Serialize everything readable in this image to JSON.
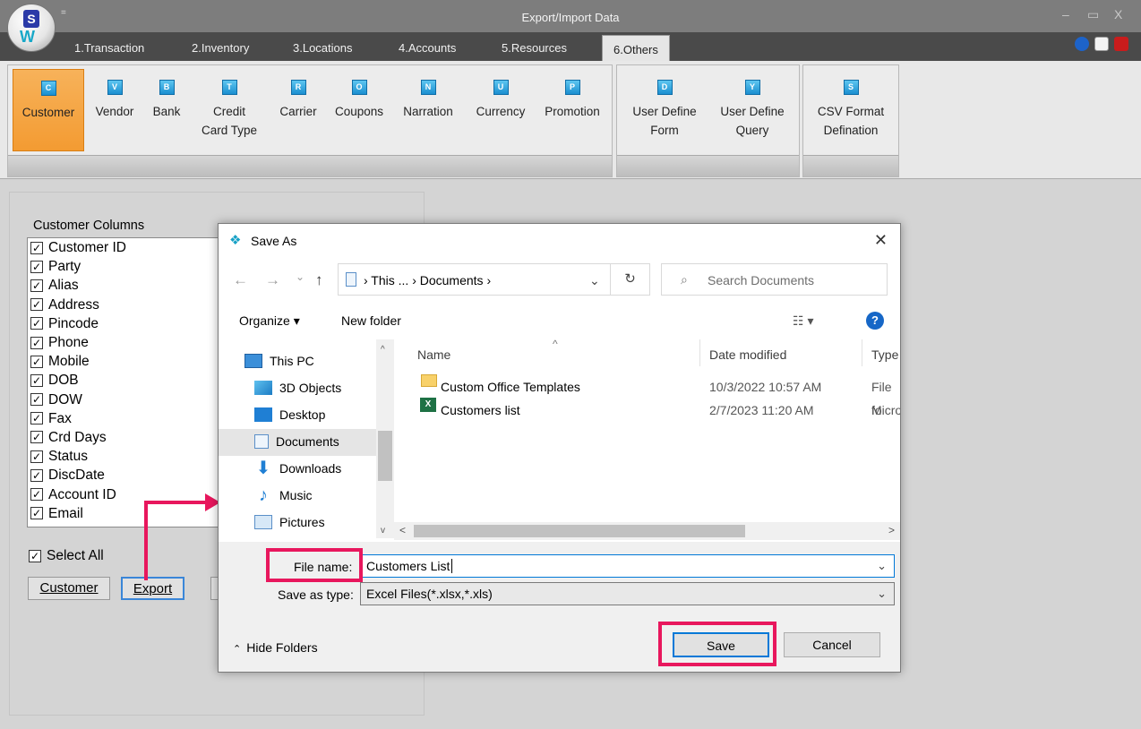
{
  "window": {
    "title": "Export/Import Data",
    "qat_symbol": "=",
    "logo_letter": "S",
    "logo_mark": "W",
    "controls": {
      "minimize": "–",
      "maximize": "▭",
      "close": "X"
    }
  },
  "tabs": [
    {
      "label": "1.Transaction"
    },
    {
      "label": "2.Inventory"
    },
    {
      "label": "3.Locations"
    },
    {
      "label": "4.Accounts"
    },
    {
      "label": "5.Resources"
    },
    {
      "label": "6.Others",
      "active": true
    }
  ],
  "ribbon": {
    "items": [
      {
        "line1": "Customer",
        "line2": "",
        "icon": "C"
      },
      {
        "line1": "Vendor",
        "line2": "",
        "icon": "V"
      },
      {
        "line1": "Bank",
        "line2": "",
        "icon": "B"
      },
      {
        "line1": "Credit",
        "line2": "Card Type",
        "icon": "T"
      },
      {
        "line1": "Carrier",
        "line2": "",
        "icon": "R"
      },
      {
        "line1": "Coupons",
        "line2": "",
        "icon": "O"
      },
      {
        "line1": "Narration",
        "line2": "",
        "icon": "N"
      },
      {
        "line1": "Currency",
        "line2": "",
        "icon": "U"
      },
      {
        "line1": "Promotion",
        "line2": "",
        "icon": "P"
      },
      {
        "line1": "User Define",
        "line2": "Form",
        "icon": "D"
      },
      {
        "line1": "User Define",
        "line2": "Query",
        "icon": "Y"
      },
      {
        "line1": "CSV Format",
        "line2": "Defination",
        "icon": "S"
      }
    ]
  },
  "panel": {
    "columns_label": "Customer Columns",
    "columns": [
      "Customer ID",
      "Party",
      "Alias",
      "Address",
      "Pincode",
      "Phone",
      "Mobile",
      "DOB",
      "DOW",
      "Fax",
      "Crd Days",
      "Status",
      "DiscDate",
      "Account ID",
      "Email"
    ],
    "check_mark": "✓",
    "select_all": "Select All",
    "customer_button": "Customer",
    "export_button": "Export"
  },
  "dialog": {
    "title": "Save As",
    "close": "✕",
    "nav": {
      "back": "←",
      "forward": "→",
      "recent": "⌄",
      "up": "↑"
    },
    "address": "›  This ...  ›  Documents  ›",
    "address_dropdown": "⌄",
    "refresh": "↻",
    "search_placeholder": "Search Documents",
    "organize": "Organize ▾",
    "new_folder": "New folder",
    "view_icon": "☷ ▾",
    "help": "?",
    "nav_items": [
      "This PC",
      "3D Objects",
      "Desktop",
      "Documents",
      "Downloads",
      "Music",
      "Pictures"
    ],
    "headers": {
      "name": "Name",
      "date": "Date modified",
      "type": "Type"
    },
    "sort_indicator": "^",
    "files": [
      {
        "name": "Custom Office Templates",
        "date": "10/3/2022 10:57 AM",
        "type": "File fo"
      },
      {
        "name": "Customers list",
        "date": "2/7/2023 11:20 AM",
        "type": "Micro"
      }
    ],
    "file_name_label": "File name:",
    "file_name_value": "Customers List",
    "save_type_label": "Save as type:",
    "save_type_value": "Excel Files(*.xlsx,*.xls)",
    "save": "Save",
    "cancel": "Cancel",
    "hide_folders": "Hide Folders"
  },
  "colors": {
    "highlight": "#e8175d",
    "ribbon_active": "#f39b32",
    "accent_blue": "#0078d7"
  }
}
